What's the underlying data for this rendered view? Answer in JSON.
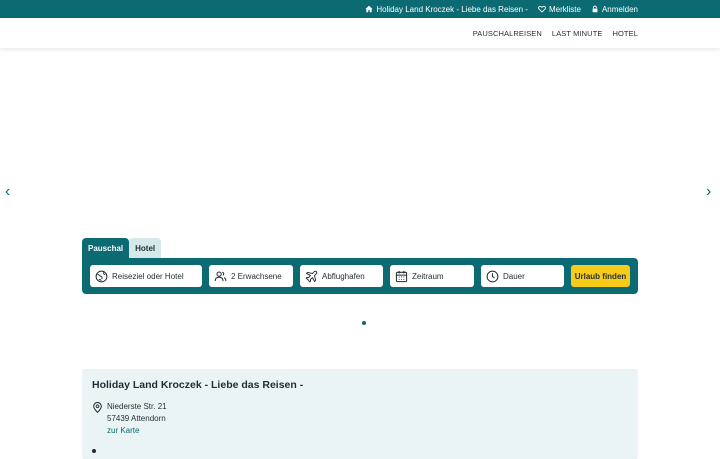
{
  "topbar": {
    "brand_link": "Holiday Land Kroczek - Liebe das Reisen -",
    "wishlist": "Merkliste",
    "login": "Anmelden"
  },
  "nav": {
    "items": [
      "PAUSCHALREISEN",
      "LAST MINUTE",
      "HOTEL"
    ]
  },
  "carousel": {
    "prev": "‹",
    "next": "›"
  },
  "search": {
    "tabs": [
      "Pauschal",
      "Hotel"
    ],
    "destination": "Reiseziel oder Hotel",
    "travellers": "2 Erwachsene",
    "airport": "Abflughafen",
    "period": "Zeitraum",
    "duration": "Dauer",
    "submit": "Urlaub finden"
  },
  "info": {
    "title": "Holiday Land Kroczek - Liebe das Reisen -",
    "street": "Niederste Str. 21",
    "city": "57439   Attendorn",
    "map_link": "zur Karte"
  },
  "colors": {
    "brand": "#0b6a72",
    "accent": "#f7cb1a",
    "info_bg": "#eaf4f5"
  }
}
